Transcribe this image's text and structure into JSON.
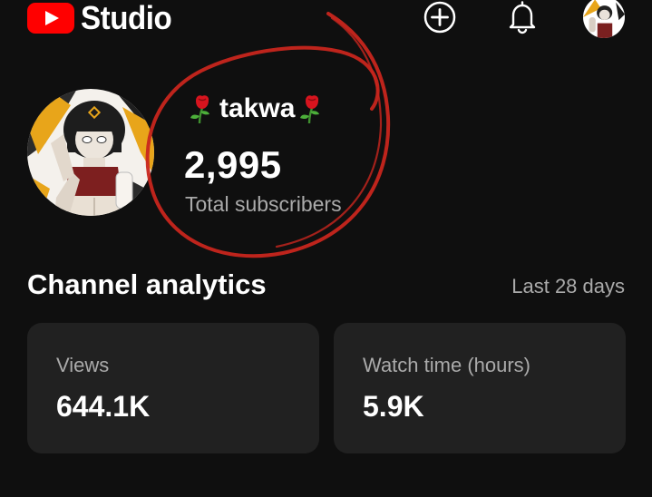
{
  "header": {
    "logo_text": "Studio",
    "icons": {
      "create": "create-plus-icon",
      "notifications": "bell-icon",
      "account": "account-avatar"
    }
  },
  "channel": {
    "name": "takwa",
    "name_decoration": "rose-emoji",
    "subscriber_count": "2,995",
    "subscriber_label": "Total subscribers"
  },
  "analytics": {
    "title": "Channel analytics",
    "period": "Last 28 days",
    "cards": [
      {
        "label": "Views",
        "value": "644.1K"
      },
      {
        "label": "Watch time (hours)",
        "value": "5.9K"
      }
    ]
  },
  "colors": {
    "background": "#0f0f0f",
    "card": "#212121",
    "brand_red": "#ff0000",
    "secondary_text": "#aaaaaa",
    "annotation_circle": "#c8261e"
  }
}
